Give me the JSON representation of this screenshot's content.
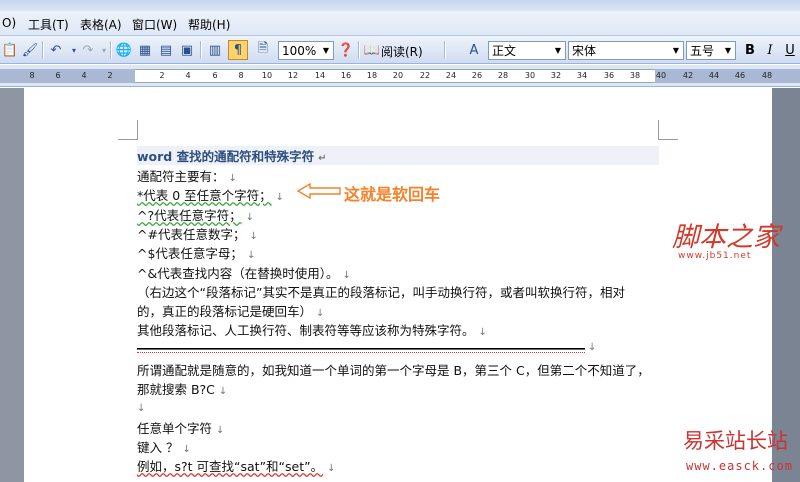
{
  "menu": {
    "items": [
      "O)",
      "工具(T)",
      "表格(A)",
      "窗口(W)",
      "帮助(H)"
    ]
  },
  "toolbar": {
    "zoom_value": "100%",
    "read_label": "阅读(R)",
    "style_value": "正文",
    "font_value": "宋体",
    "size_value": "五号",
    "bold_label": "B",
    "italic_label": "I",
    "underline_label": "U"
  },
  "ruler": {
    "ticks": [
      "8",
      "6",
      "4",
      "2",
      "2",
      "4",
      "6",
      "8",
      "10",
      "12",
      "14",
      "16",
      "18",
      "20",
      "22",
      "24",
      "26",
      "28",
      "30",
      "32",
      "34",
      "36",
      "38",
      "40",
      "42",
      "44",
      "46",
      "48"
    ]
  },
  "document": {
    "title": "word 查找的通配符和特殊字符",
    "lines": [
      "通配符主要有：",
      "*代表 0 至任意个字符；",
      "^?代表任意字符；",
      "^#代表任意数字；",
      "^$代表任意字母；",
      "^&代表查找内容（在替换时使用）。",
      "（右边这个“段落标记”其实不是真正的段落标记，叫手动换行符，或者叫软换行符，相对",
      "的，真正的段落标记是硬回车）",
      "其他段落标记、人工换行符、制表符等等应该称为特殊字符。",
      "所谓通配就是随意的，如我知道一个单词的第一个字母是 B，第三个 C，但第二个不知道了，",
      "那就搜索 B?C",
      "",
      "任意单个字符",
      "键入 ？",
      "例如，s?t 可查找“sat”和“set”。"
    ],
    "annotation": "这就是软回车"
  },
  "watermarks": {
    "top": "脚本之家",
    "top_sub": "www.jb51.net",
    "bottom": "易采站长站",
    "bottom_sub": "www.easck.com"
  },
  "colors": {
    "annotation": "#f5822a",
    "title": "#2d4f7f",
    "watermark": "#d13a2a"
  }
}
